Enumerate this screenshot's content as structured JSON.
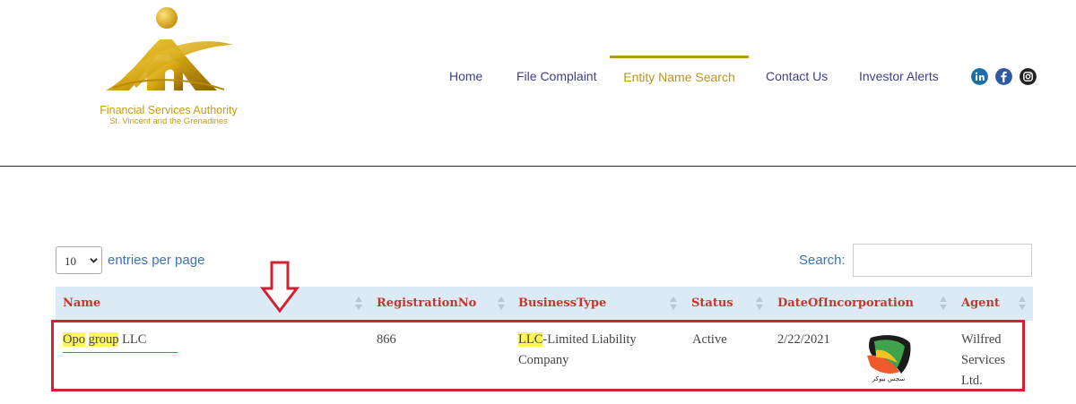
{
  "logo": {
    "line1": "Financial Services Authority",
    "line2": "St. Vincent and the Grenadines"
  },
  "nav": {
    "items": [
      {
        "label": "Home"
      },
      {
        "label": "File Complaint"
      },
      {
        "label": "Entity Name Search",
        "active": true
      },
      {
        "label": "Contact Us"
      },
      {
        "label": "Investor Alerts"
      }
    ],
    "social": [
      "linkedin-icon",
      "facebook-icon",
      "instagram-icon"
    ]
  },
  "controls": {
    "per_page_value": "10",
    "per_page_label": "entries per page",
    "search_label": "Search:",
    "search_value": ""
  },
  "table": {
    "columns": [
      "Name",
      "RegistrationNo",
      "BusinessType",
      "Status",
      "DateOfIncorporation",
      "Agent"
    ],
    "row": {
      "name_parts": [
        "Opo",
        "group",
        "LLC"
      ],
      "registration_no": "866",
      "business_type_hl": "LLC",
      "business_type_rest": "-Limited Liability",
      "business_type_line2": "Company",
      "status": "Active",
      "date": "2/22/2021",
      "agent_logo_text": "سجس بيوكر",
      "agent_lines": [
        "Wilfred",
        "Services",
        "Ltd."
      ]
    }
  },
  "colors": {
    "nav": "#3d3f8c",
    "nav_active": "#b8961d",
    "header_text": "#c0392b",
    "header_bg": "#dceaf6",
    "link_blue": "#3a74b0",
    "highlight": "#fbf75a",
    "annotation_red": "#d0232f"
  }
}
